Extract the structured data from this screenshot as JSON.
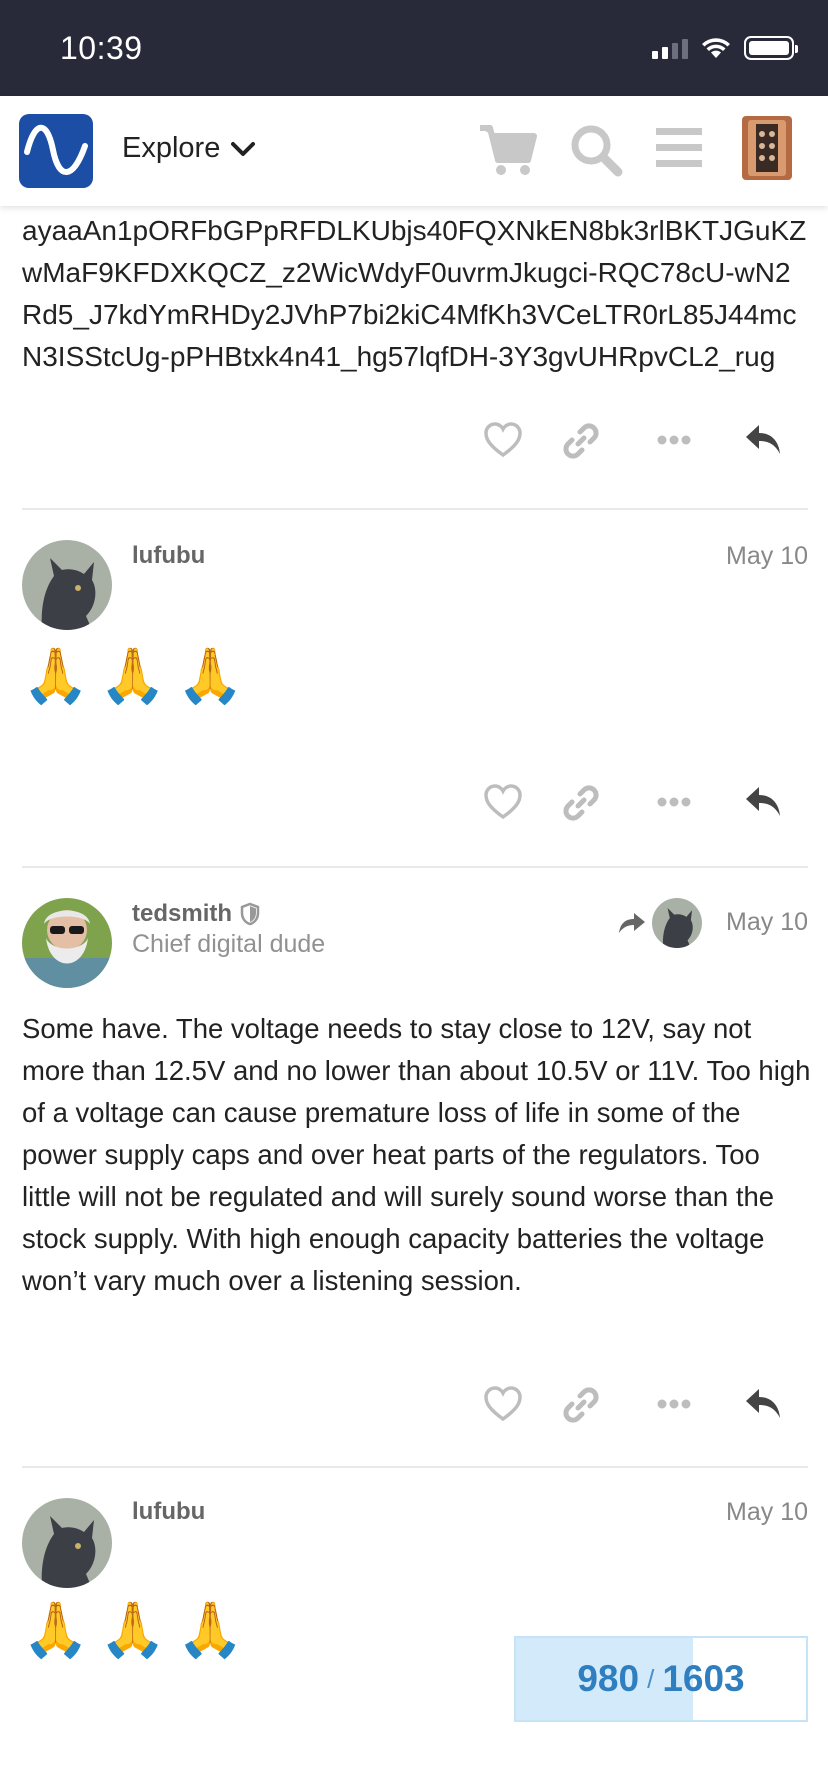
{
  "status_bar": {
    "time": "10:39"
  },
  "header": {
    "nav_label": "Explore"
  },
  "top_post": {
    "text": "ayaaAn1pORFbGPpRFDLKUbjs40FQXNkEN8bk3rlBKTJGuKZwMaF9KFDXKQCZ_z2WicWdyF0uvrmJkugci-RQC78cU-wN2Rd5_J7kdYmRHDy2JVhP7bi2kiC4MfKh3VCeLTR0rL85J44mcN3ISStcUg-pPHBtxk4n41_hg57lqfDH-3Y3gvUHRpvCL2_rug"
  },
  "posts": [
    {
      "username": "lufubu",
      "date": "May 10",
      "emojis": [
        "🙏",
        "🙏",
        "🙏"
      ]
    },
    {
      "username": "tedsmith",
      "user_title": "Chief digital dude",
      "date": "May 10",
      "body": "Some have. The voltage needs to stay close to 12V, say not more than 12.5V and no lower than about 10.5V or 11V. Too high of a voltage can cause premature loss of life in some of the power supply caps and over heat parts of the regulators. Too little will not be regulated and will surely sound worse than the stock supply. With high enough capacity batteries the voltage won’t vary much over a listening session."
    },
    {
      "username": "lufubu",
      "date": "May 10",
      "emojis": [
        "🙏",
        "🙏",
        "🙏"
      ]
    }
  ],
  "progress": {
    "current": "980",
    "separator": "/",
    "total": "1603",
    "fraction": 0.611
  },
  "colors": {
    "status_bar": "#282a3a",
    "brand": "#1c4ea6",
    "progress_fill": "#d2eaf9",
    "progress_text": "#2f7fc0"
  }
}
